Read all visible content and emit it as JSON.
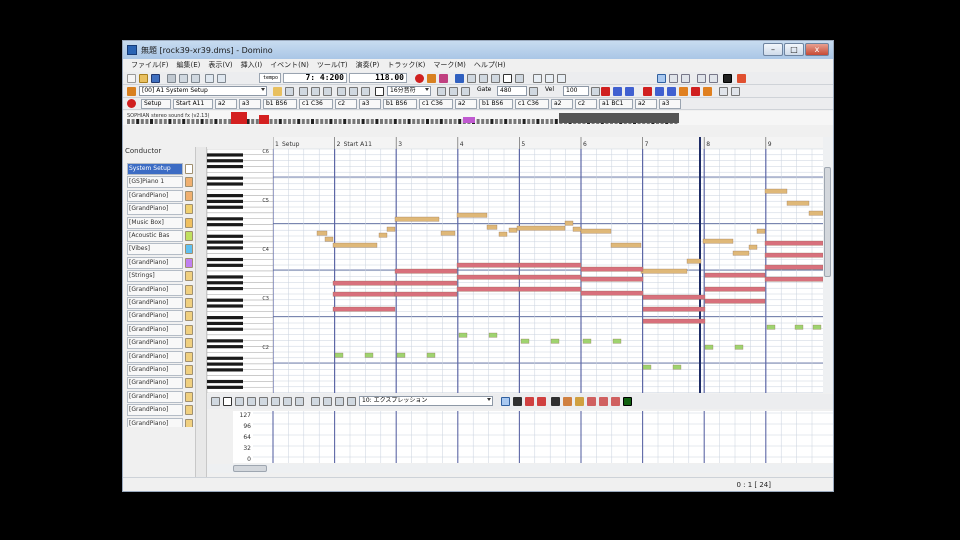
{
  "window": {
    "title": "無題 [rock39-xr39.dms] - Domino",
    "buttons": {
      "minimize": "–",
      "maximize": "□",
      "close": "x"
    }
  },
  "menu": [
    "ファイル(F)",
    "編集(E)",
    "表示(V)",
    "挿入(I)",
    "イベント(N)",
    "ツール(T)",
    "演奏(P)",
    "トラック(K)",
    "マーク(M)",
    "ヘルプ(H)"
  ],
  "transport": {
    "tempo_label": "tempo",
    "position": "7: 4:200",
    "tempo": "118.00"
  },
  "toolbar2": {
    "track_select": "[00] A1 System Setup",
    "pencil_select": "16分音符",
    "gate_label": "Gate",
    "gate_value": "480",
    "vel_label": "Vel",
    "vel_value": "100"
  },
  "marker_labels": [
    "Setup",
    "Start A11",
    "a2",
    "a3",
    "b1 BS6",
    "c1 C36",
    "c2",
    "a3",
    "b1 BS6",
    "c1 C36",
    "a2",
    "b1 BS6",
    "c1 C36",
    "a2",
    "c2",
    "a1 BC1",
    "a2",
    "a3"
  ],
  "strip_text": "SOPHIAN stereo sound fx (v2.13)",
  "conductor_label": "Conductor",
  "tracks": [
    {
      "name": "System Setup",
      "color": "#ffffff",
      "selected": true
    },
    {
      "name": "[GS]Piano 1",
      "color": "#f0b070"
    },
    {
      "name": "[GrandPiano]",
      "color": "#f0b070"
    },
    {
      "name": "[GrandPiano]",
      "color": "#f0d070"
    },
    {
      "name": "[Music Box]",
      "color": "#f0c060"
    },
    {
      "name": "[Acoustic Bas",
      "color": "#c0e060"
    },
    {
      "name": "[Vibes]",
      "color": "#60c0f0"
    },
    {
      "name": "[GrandPiano]",
      "color": "#c080f0"
    },
    {
      "name": "[Strings]",
      "color": "#f0d080"
    },
    {
      "name": "[GrandPiano]",
      "color": "#f0d080"
    },
    {
      "name": "[GrandPiano]",
      "color": "#f0d080"
    },
    {
      "name": "[GrandPiano]",
      "color": "#f0d080"
    },
    {
      "name": "[GrandPiano]",
      "color": "#f0d080"
    },
    {
      "name": "[GrandPiano]",
      "color": "#f0d080"
    },
    {
      "name": "[GrandPiano]",
      "color": "#f0d080"
    },
    {
      "name": "[GrandPiano]",
      "color": "#f0d080"
    },
    {
      "name": "[GrandPiano]",
      "color": "#f0d080"
    },
    {
      "name": "[GrandPiano]",
      "color": "#f0d080"
    },
    {
      "name": "[GrandPiano]",
      "color": "#f0d080"
    },
    {
      "name": "[GrandPiano]",
      "color": "#f0d080"
    }
  ],
  "measure_headers": [
    {
      "num": "1",
      "label": "Setup"
    },
    {
      "num": "2",
      "label": "Start A11"
    },
    {
      "num": "3",
      "label": ""
    },
    {
      "num": "4",
      "label": ""
    },
    {
      "num": "5",
      "label": ""
    },
    {
      "num": "6",
      "label": ""
    },
    {
      "num": "7",
      "label": ""
    },
    {
      "num": "8",
      "label": ""
    },
    {
      "num": "9",
      "label": ""
    }
  ],
  "octave_labels": [
    "C6",
    "C5",
    "C4",
    "C3",
    "C2",
    "C1"
  ],
  "controller_select": "10: エクスプレッション",
  "velocity_axis": [
    "127",
    "96",
    "64",
    "32",
    "0"
  ],
  "status": "0 : 1 [ 24]",
  "colors": {
    "melody": "#dfb878",
    "harmony": "#d8707c",
    "bass": "#9fd36f",
    "bar_line": "#5d67a6",
    "grid": "#c9d2de",
    "selection": "#3c6cc4"
  }
}
